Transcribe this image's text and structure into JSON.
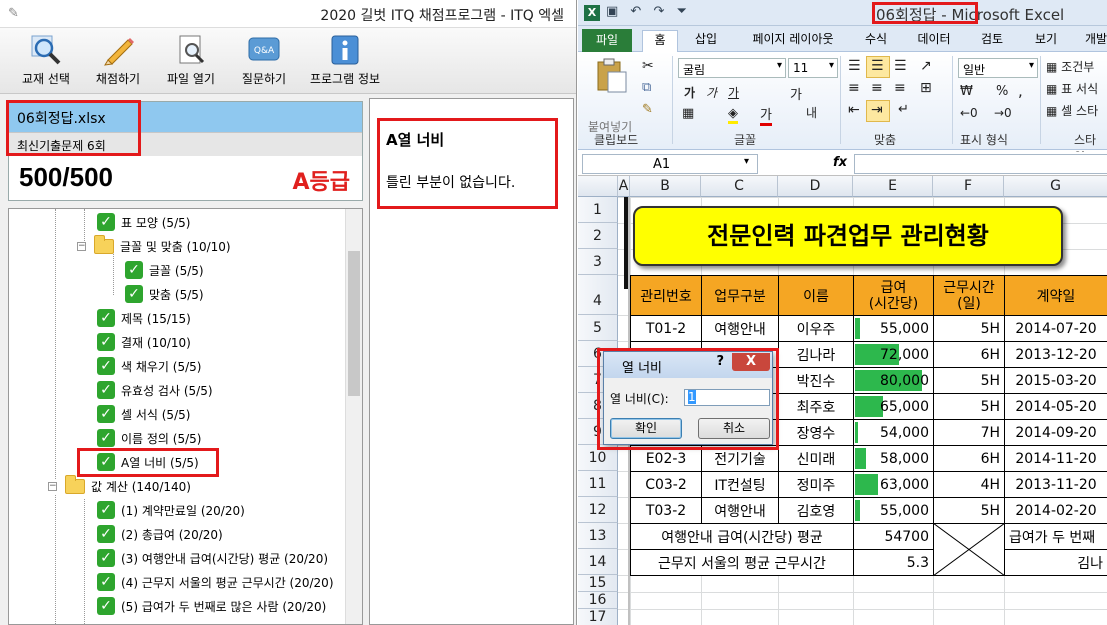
{
  "left_app": {
    "title": "2020 길벗 ITQ 채점프로그램 - ITQ 엑셀",
    "toolbar": [
      {
        "label": "교재 선택",
        "icon": "magnifier-icon"
      },
      {
        "label": "채점하기",
        "icon": "pencil-icon"
      },
      {
        "label": "파일 열기",
        "icon": "document-search-icon"
      },
      {
        "label": "질문하기",
        "icon": "qa-icon"
      },
      {
        "label": "프로그램 정보",
        "icon": "info-icon"
      }
    ],
    "file_name": "06회정답.xlsx",
    "exam_name": "최신기출문제 6회",
    "score": "500/500",
    "grade": "A등급",
    "tree": [
      {
        "label": "표 모양 (5/5)",
        "type": "check"
      },
      {
        "label": "글꼴 및 맞춤 (10/10)",
        "type": "folder"
      },
      {
        "label": "글꼴 (5/5)",
        "type": "check"
      },
      {
        "label": "맞춤 (5/5)",
        "type": "check"
      },
      {
        "label": "제목 (15/15)",
        "type": "check"
      },
      {
        "label": "결재 (10/10)",
        "type": "check"
      },
      {
        "label": "색 채우기 (5/5)",
        "type": "check"
      },
      {
        "label": "유효성 검사 (5/5)",
        "type": "check"
      },
      {
        "label": "셀 서식 (5/5)",
        "type": "check"
      },
      {
        "label": "이름 정의 (5/5)",
        "type": "check"
      },
      {
        "label": "A열 너비 (5/5)",
        "type": "check"
      },
      {
        "label": "값 계산 (140/140)",
        "type": "folder"
      },
      {
        "label": "(1) 계약만료일 (20/20)",
        "type": "check"
      },
      {
        "label": "(2) 총급여 (20/20)",
        "type": "check"
      },
      {
        "label": "(3) 여행안내 급여(시간당) 평균 (20/20)",
        "type": "check"
      },
      {
        "label": "(4) 근무지 서울의 평균 근무시간 (20/20)",
        "type": "check"
      },
      {
        "label": "(5) 급여가 두 번째로 많은 사람 (20/20)",
        "type": "check"
      }
    ],
    "detail_title": "A열 너비",
    "detail_message": "틀린 부분이 없습니다."
  },
  "excel": {
    "title_file": "06회정답",
    "title_rest": " - Microsoft Excel",
    "tabs": [
      "파일",
      "홈",
      "삽입",
      "페이지 레이아웃",
      "수식",
      "데이터",
      "검토",
      "보기",
      "개발"
    ],
    "ribbon": {
      "paste_label": "붙여넣기",
      "clipboard_label": "클립보드",
      "font_name": "굴림",
      "font_size": "11",
      "font_label": "글꼴",
      "align_label": "맞춤",
      "number_format": "일반",
      "number_label": "표시 형식",
      "style_items": [
        "조건부",
        "표 서식",
        "셀 스타"
      ],
      "style_label": "스타일",
      "font_glyphs": [
        "가",
        "가",
        "가",
        "가"
      ],
      "wrap_glyph": "내",
      "percent_glyph": "%",
      "comma_glyph": ","
    },
    "name_box": "A1",
    "fx": "fx",
    "columns": [
      "A",
      "B",
      "C",
      "D",
      "E",
      "F",
      "G"
    ],
    "rows": [
      "1",
      "2",
      "3",
      "4",
      "5",
      "6",
      "7",
      "8",
      "9",
      "10",
      "11",
      "12",
      "13",
      "14",
      "15",
      "16",
      "17"
    ],
    "banner_title": "전문인력 파견업무 관리현황",
    "table_headers": [
      "관리번호",
      "업무구분",
      "이름",
      "급여\n(시간당)",
      "근무시간\n(일)",
      "계약일"
    ],
    "table_rows": [
      [
        "T01-2",
        "여행안내",
        "이우주",
        "55,000",
        "5H",
        "2014-07-20"
      ],
      [
        "",
        "",
        "김나라",
        "72,000",
        "6H",
        "2013-12-20"
      ],
      [
        "",
        "",
        "박진수",
        "80,000",
        "5H",
        "2015-03-20"
      ],
      [
        "",
        "",
        "최주호",
        "65,000",
        "5H",
        "2014-05-20"
      ],
      [
        "",
        "",
        "장영수",
        "54,000",
        "7H",
        "2014-09-20"
      ],
      [
        "E02-3",
        "전기기술",
        "신미래",
        "58,000",
        "6H",
        "2014-11-20"
      ],
      [
        "C03-2",
        "IT컨설팅",
        "정미주",
        "63,000",
        "4H",
        "2013-11-20"
      ],
      [
        "T03-2",
        "여행안내",
        "김호영",
        "55,000",
        "5H",
        "2014-02-20"
      ]
    ],
    "salary_bar_fractions": [
      0.06,
      0.57,
      0.87,
      0.37,
      0.0,
      0.14,
      0.3,
      0.06
    ],
    "row13_label": "여행안내 급여(시간당) 평균",
    "row13_value": "54700",
    "row13_right": "급여가 두 번째",
    "row14_label": "근무지 서울의 평균 근무시간",
    "row14_value": "5.3",
    "row14_right": "김나",
    "dialog": {
      "title": "열 너비",
      "help": "?",
      "close": "X",
      "field_label": "열 너비(C):",
      "field_value": "1",
      "ok_label": "확인",
      "cancel_label": "취소"
    }
  },
  "colors": {
    "highlight_red": "#e3191b",
    "check_green": "#2ea52e",
    "header_orange": "#f5a623",
    "banner_yellow": "#ffff00",
    "bar_green": "#2db84d",
    "grade_red": "#e0201e"
  }
}
